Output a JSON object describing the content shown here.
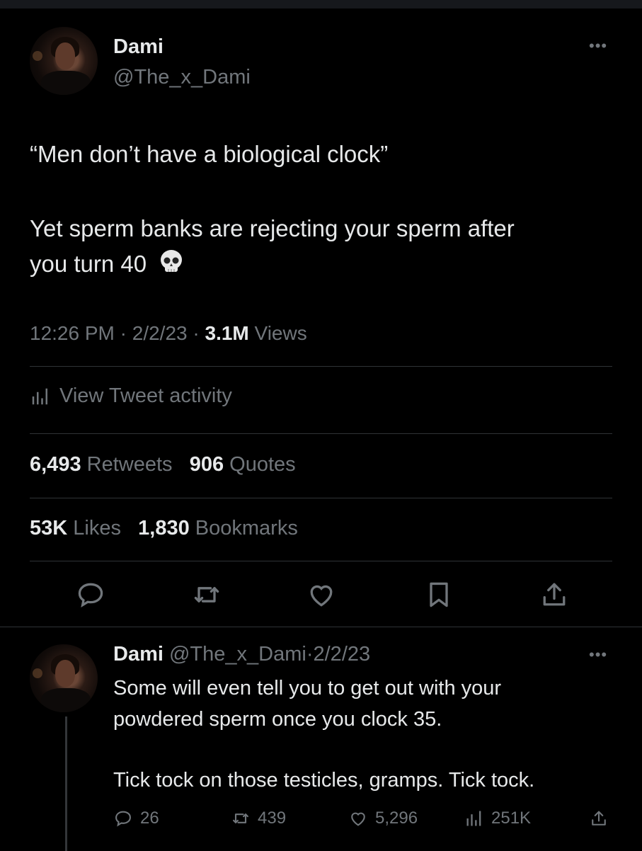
{
  "main_tweet": {
    "author_name": "Dami",
    "author_handle": "@The_x_Dami",
    "more_icon": "more-horizontal-icon",
    "text_line1": "“Men don’t have a biological clock”",
    "text_line2": "Yet sperm banks are rejecting your sperm after",
    "text_line3": "you turn 40",
    "emoji": "skull-emoji",
    "time": "12:26 PM",
    "date": "2/2/23",
    "views_count": "3.1M",
    "views_label": "Views",
    "activity_label": "View Tweet activity",
    "retweets_count": "6,493",
    "retweets_label": "Retweets",
    "quotes_count": "906",
    "quotes_label": "Quotes",
    "likes_count": "53K",
    "likes_label": "Likes",
    "bookmarks_count": "1,830",
    "bookmarks_label": "Bookmarks",
    "actions": [
      "reply-icon",
      "retweet-icon",
      "like-icon",
      "bookmark-icon",
      "share-icon"
    ]
  },
  "reply_tweet": {
    "author_name": "Dami",
    "author_handle": "@The_x_Dami",
    "separator": "·",
    "date": "2/2/23",
    "text_line1": "Some will even tell you to get out with your",
    "text_line2": "powdered sperm once you clock 35.",
    "text_line3": "Tick tock on those testicles, gramps. Tick tock.",
    "reply_count": "26",
    "retweet_count": "439",
    "like_count": "5,296",
    "views_count": "251K"
  },
  "colors": {
    "background": "#000000",
    "text": "#e7e9ea",
    "muted": "#71767b",
    "divider": "#2f3336"
  }
}
